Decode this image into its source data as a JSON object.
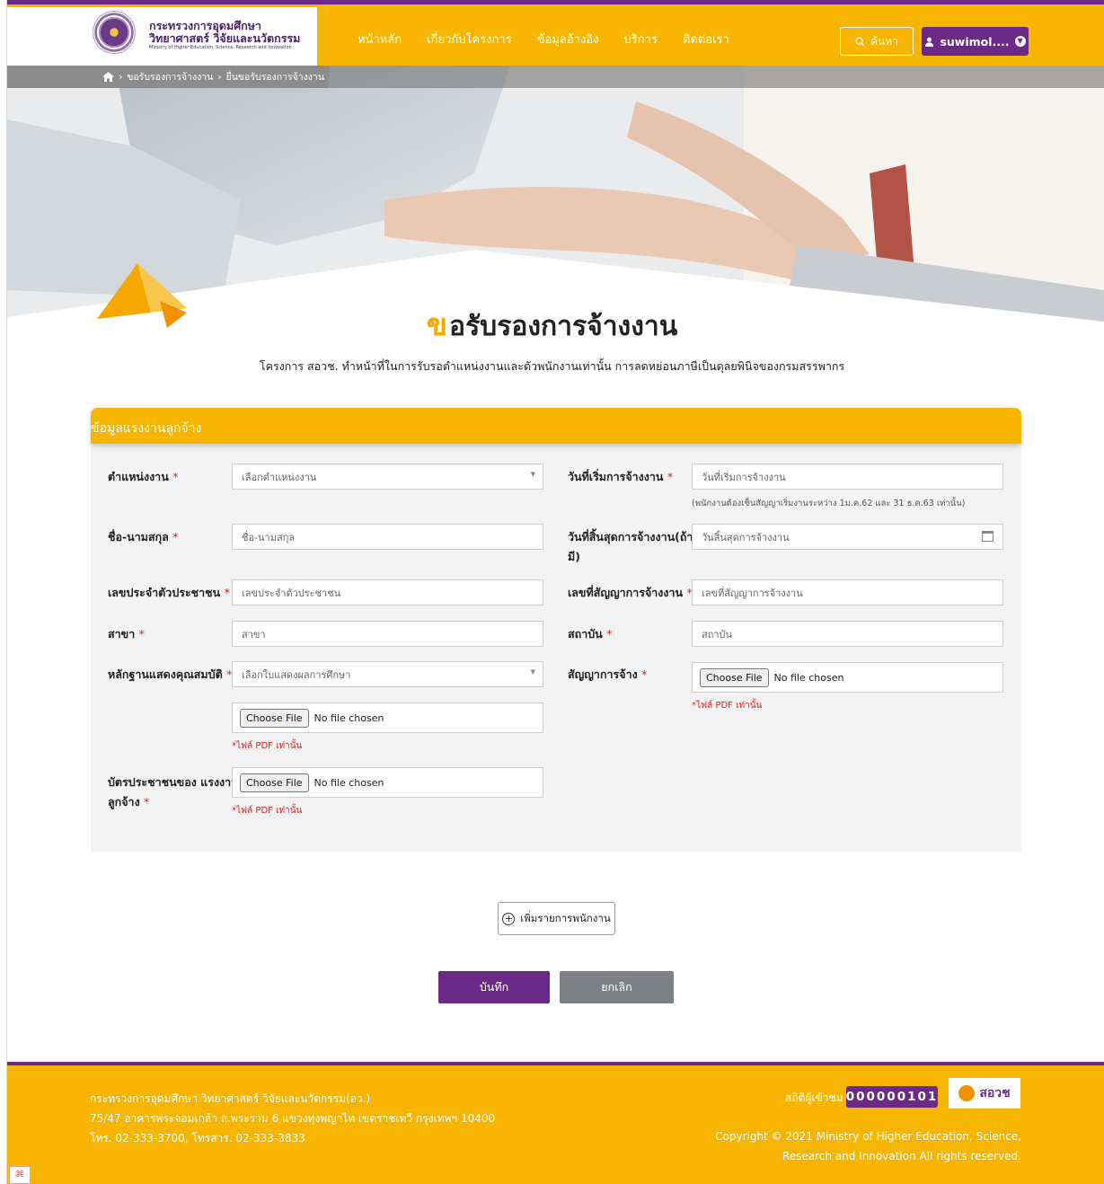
{
  "header": {
    "logo_th_line1": "กระทรวงการอุดมศึกษา",
    "logo_th_line2": "วิทยาศาสตร์ วิจัยและนวัตกรรม",
    "logo_en": "Ministry of Higher Education, Science, Research and Innovation",
    "nav": [
      "หน้าหลัก",
      "เกี่ยวกับโครงการ",
      "ข้อมูลอ้างอิง",
      "บริการ",
      "ติดต่อเรา"
    ],
    "search_label": "ค้นหา",
    "user_label": "suwimol...."
  },
  "breadcrumb": [
    "ขอรับรองการจ้างงาน",
    "ยื่นขอรับรองการจ้างงาน"
  ],
  "page": {
    "title_first": "ข",
    "title_rest": "อรับรองการจ้างงาน",
    "subtitle": "โครงการ สอวช. ทำหน้าที่ในการรับรอตำแหน่งงานและตัวพนักงานเท่านั้น การลดหย่อนภาษีเป็นดุลยพินิจของกรมสรรพากร"
  },
  "form": {
    "section_title": "ข้อมูลแรงงานลูกจ้าง",
    "position_label": "ตำแหน่งงาน",
    "position_value": "เลือกตำแหน่งงาน",
    "start_label": "วันที่เริ่มการจ้างงาน",
    "start_placeholder": "วันที่เริ่มการจ้างงาน",
    "start_hint": "(พนักงานต้องเซ็นสัญญาเริ่มงานระหว่าง 1ม.ค.62 และ 31 ธ.ค.63 เท่านั้น)",
    "name_label": "ชื่อ-นามสกุล",
    "name_placeholder": "ชื่อ-นามสกุล",
    "end_label_1": "วันที่สิ้นสุดการจ้างงาน(ถ้า",
    "end_label_2": "มี)",
    "end_placeholder": "วันสิ้นสุดการจ้างงาน",
    "id_label": "เลขประจำตัวประชาชน",
    "id_placeholder": "เลขประจำตัวประชาชน",
    "contract_no_label": "เลขที่สัญญาการจ้างงาน",
    "contract_no_placeholder": "เลขที่สัญญาการจ้างงาน",
    "branch_label": "สาขา",
    "branch_placeholder": "สาขา",
    "institute_label": "สถาบัน",
    "institute_placeholder": "สถาบัน",
    "qual_label": "หลักฐานแสดงคุณสมบัติ",
    "qual_value": "เลือกใบแสดงผลการศึกษา",
    "contract_label": "สัญญาการจ้าง",
    "choose_file": "Choose File",
    "no_file": "No file chosen",
    "pdf_only": "*ไฟล์ PDF เท่านั้น",
    "idcard_label_1": "บัตรประชาชนของ แรงงาน",
    "idcard_label_2": "ลูกจ้าง",
    "required_mark": "*"
  },
  "actions": {
    "add_label": "เพิ่มรายการพนักงาน",
    "save_label": "บันทึก",
    "cancel_label": "ยกเลิก"
  },
  "footer": {
    "org": "กระทรวงการอุดมศึกษา วิทยาศาสตร์ วิจัยและนวัตกรรม(อว.)",
    "address": "75/47 อาคารพระจอมเกล้า ถ.พระราม 6 แขวงทุ่งพญาไท เขตราชเทวี กรุงเทพฯ 10400",
    "phone": "โทร. 02-333-3700, โทรสาร. 02-333-3833",
    "visits_label": "สถิติผู้เข้าชม",
    "visits": "000000101",
    "brand": "สอวช",
    "copyright_1": "Copyright © 2021 Ministry of Higher Education, Science,",
    "copyright_2": "Research and Innovation All rights reserved."
  },
  "colors": {
    "primary_yellow": "#f7b500",
    "primary_purple": "#6b2a86",
    "cancel_gray": "#7d8186",
    "required_red": "#e02020"
  },
  "icons": [
    "home-icon",
    "search-icon",
    "user-icon",
    "chevron-down-icon",
    "calendar-icon",
    "plus-circle-icon",
    "caret-down-icon"
  ]
}
